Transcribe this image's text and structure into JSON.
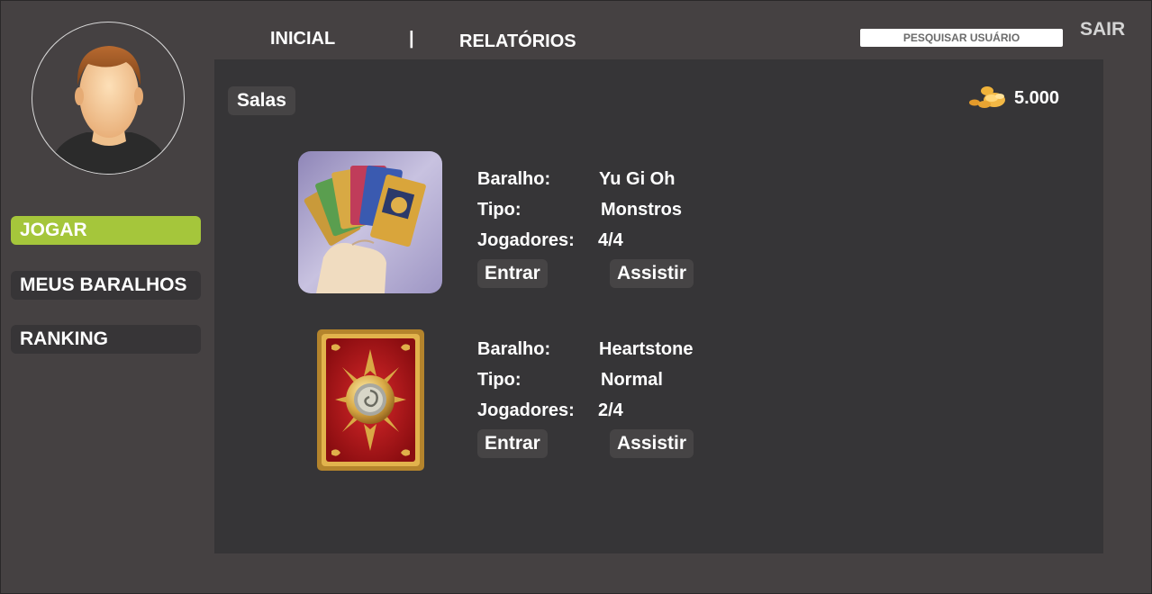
{
  "nav": {
    "inicial": "INICIAL",
    "separator": "|",
    "relatorios": "RELATÓRIOS",
    "search_placeholder": "PESQUISAR USUÁRIO",
    "sair": "SAIR"
  },
  "sidebar": {
    "items": [
      {
        "label": "JOGAR",
        "active": true
      },
      {
        "label": "MEUS BARALHOS",
        "active": false
      },
      {
        "label": "RANKING",
        "active": false
      }
    ]
  },
  "main": {
    "section_title": "Salas",
    "coins": "5.000",
    "coins_icon": "coins-icon",
    "rooms": [
      {
        "image_icon": "yugioh-cards-image",
        "deck_label": "Baralho:",
        "deck_value": "Yu Gi Oh",
        "type_label": "Tipo:",
        "type_value": "Monstros",
        "players_label": "Jogadores:",
        "players_value": "4/4",
        "enter_label": "Entrar",
        "watch_label": "Assistir"
      },
      {
        "image_icon": "hearthstone-card-back-image",
        "deck_label": "Baralho:",
        "deck_value": "Heartstone",
        "type_label": "Tipo:",
        "type_value": "Normal",
        "players_label": "Jogadores:",
        "players_value": "2/4",
        "enter_label": "Entrar",
        "watch_label": "Assistir"
      }
    ]
  },
  "colors": {
    "background": "#454142",
    "panel": "#363537",
    "active_accent": "#a5c63b",
    "button_bg": "#373537"
  }
}
